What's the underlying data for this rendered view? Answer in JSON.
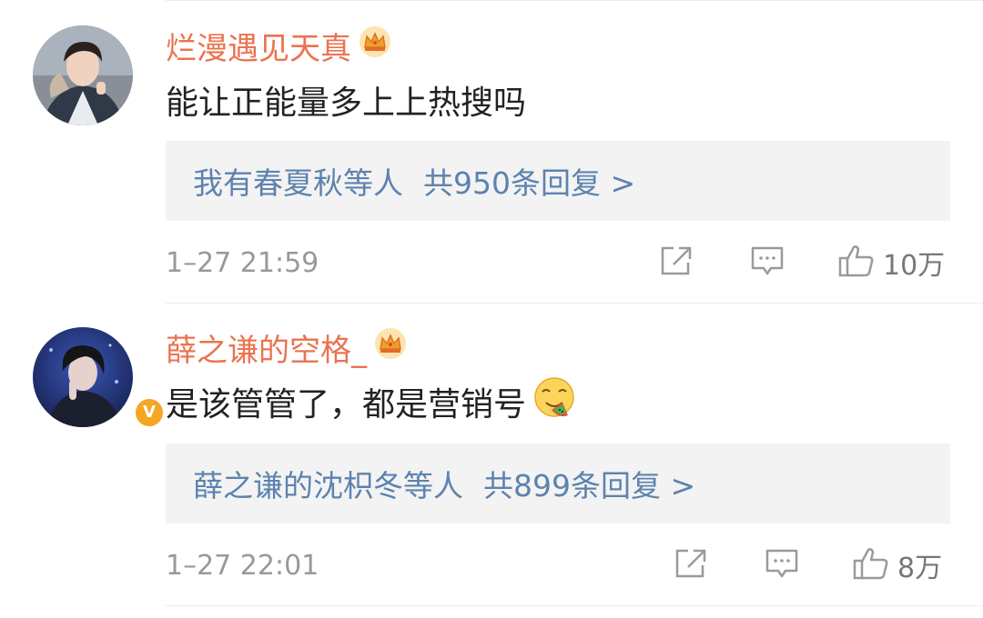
{
  "comments": [
    {
      "username": "烂漫遇见天真",
      "content": "能让正能量多上上热搜吗",
      "reply_users": "我有春夏秋等人",
      "reply_count": "共950条回复 >",
      "time": "1–27 21:59",
      "likes": "10万",
      "verified": false,
      "has_emoji": false
    },
    {
      "username": "薛之谦的空格_",
      "content": "是该管管了，都是营销号",
      "reply_users": "薛之谦的沈枳冬等人",
      "reply_count": "共899条回复 >",
      "time": "1–27 22:01",
      "likes": "8万",
      "verified": true,
      "has_emoji": true
    }
  ],
  "colors": {
    "username": "#eb7350",
    "reply_link": "#5d83ae",
    "reply_bg": "#f3f3f3",
    "meta_text": "#999999",
    "verified_badge": "#f5a623"
  },
  "icons": {
    "crown": "crown-icon",
    "repost": "repost-icon",
    "comment": "comment-icon",
    "like": "thumbs-up-icon",
    "verified": "verified-badge-icon",
    "emoji": "drooling-face-emoji"
  }
}
